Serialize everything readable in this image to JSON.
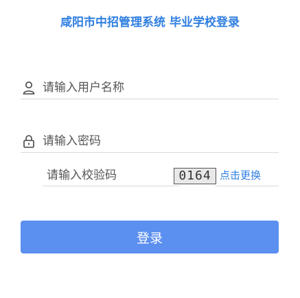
{
  "title": "咸阳市中招管理系统 毕业学校登录",
  "username": {
    "placeholder": "请输入用户名称",
    "icon": "user-icon"
  },
  "password": {
    "placeholder": "请输入密码",
    "icon": "lock-icon"
  },
  "captcha": {
    "placeholder": "请输入校验码",
    "code": "0164",
    "refresh_label": "点击更换"
  },
  "login_button": {
    "label": "登录"
  },
  "colors": {
    "accent": "#2f7fe0",
    "button": "#5b8ff0",
    "divider": "#d8d8d8"
  }
}
